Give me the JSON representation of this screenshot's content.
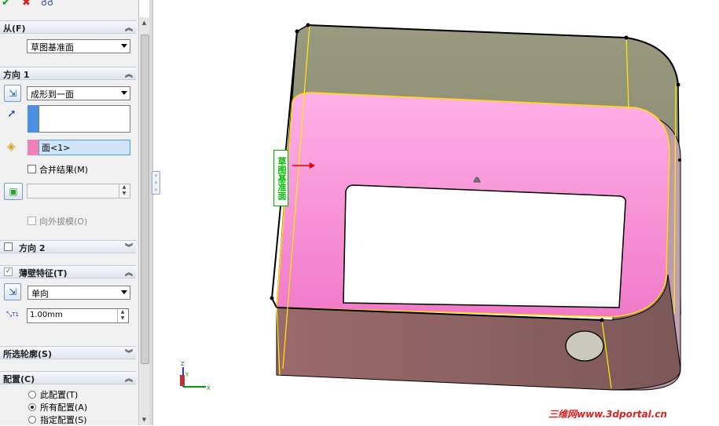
{
  "toolbar": {
    "ok_icon": "check-icon",
    "cancel_icon": "cross-icon",
    "preview_icon": "glasses-icon",
    "ok_color": "#1a9a1a",
    "cancel_color": "#d42020"
  },
  "from_section": {
    "title": "从(F)",
    "select_value": "草图基准面"
  },
  "direction1": {
    "title": "方向 1",
    "end_condition": "成形到一面",
    "face_value": "面<1>",
    "merge_label": "合并结果(M)",
    "draft_label": "向外拔模(O)",
    "face_color": "#f080b8",
    "direction_color": "#4a90e2"
  },
  "direction2": {
    "title": "方向 2"
  },
  "thin_feature": {
    "title": "薄壁特征(T)",
    "type_value": "单向",
    "thickness_value": "1.00mm",
    "thickness_symbol": "T1"
  },
  "selected_contours": {
    "title": "所选轮廓(S)"
  },
  "configurations": {
    "title": "配置(C)",
    "options": [
      "此配置(T)",
      "所有配置(A)",
      "指定配置(S)"
    ],
    "selected_index": 1
  },
  "viewport": {
    "sketch_plane_label": "草图基准面",
    "watermark": "三维网www.3dportal.cn",
    "face_color": "#ff90d8",
    "body_color": "#8f8f74",
    "axis_labels": [
      "Z",
      "Y",
      "X"
    ]
  }
}
